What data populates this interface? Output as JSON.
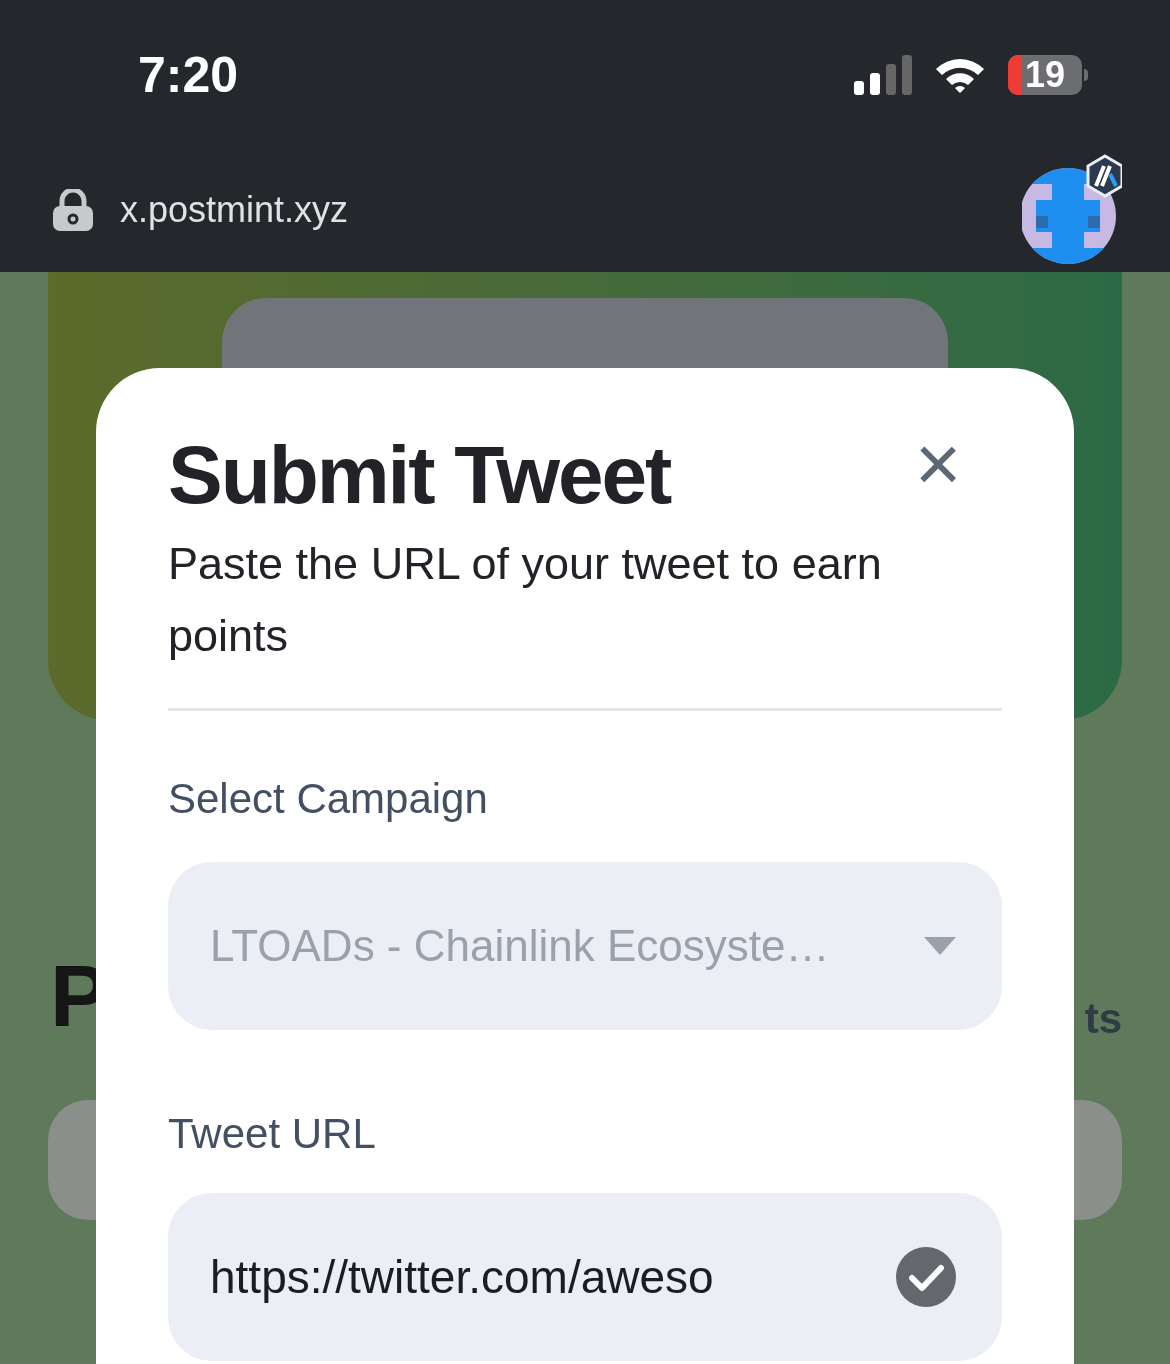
{
  "status_bar": {
    "time": "7:20",
    "battery": "19"
  },
  "browser": {
    "url": "x.postmint.xyz"
  },
  "background": {
    "heading": "P",
    "side_text": "ts"
  },
  "modal": {
    "title": "Submit Tweet",
    "close": "×",
    "subtitle": "Paste the URL of your tweet to earn points",
    "fields": [
      {
        "kind": "select",
        "label": "Select Campaign",
        "value": "LTOADs - Chainlink Ecosyste…",
        "disabled": true
      },
      {
        "kind": "input",
        "label": "Tweet URL",
        "value": "https://twitter.com/aweso",
        "valid": true
      }
    ]
  }
}
